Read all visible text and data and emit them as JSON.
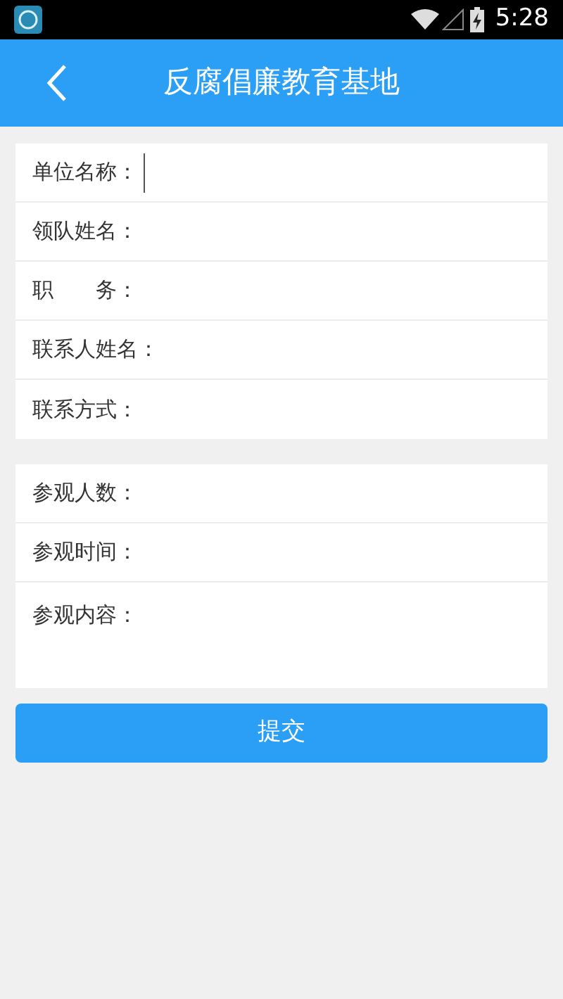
{
  "status_bar": {
    "time": "5:28"
  },
  "header": {
    "title": "反腐倡廉教育基地"
  },
  "sections": [
    {
      "fields": [
        {
          "label": "单位名称：",
          "focused": true,
          "kind": "line"
        },
        {
          "label": "领队姓名：",
          "focused": false,
          "kind": "line"
        },
        {
          "label": "职　　务：",
          "focused": false,
          "kind": "line"
        },
        {
          "label": "联系人姓名：",
          "focused": false,
          "kind": "line"
        },
        {
          "label": "联系方式：",
          "focused": false,
          "kind": "line"
        }
      ]
    },
    {
      "fields": [
        {
          "label": "参观人数：",
          "focused": false,
          "kind": "line"
        },
        {
          "label": "参观时间：",
          "focused": false,
          "kind": "line"
        },
        {
          "label": "参观内容：",
          "focused": false,
          "kind": "area"
        }
      ]
    }
  ],
  "submit_button": "提交"
}
